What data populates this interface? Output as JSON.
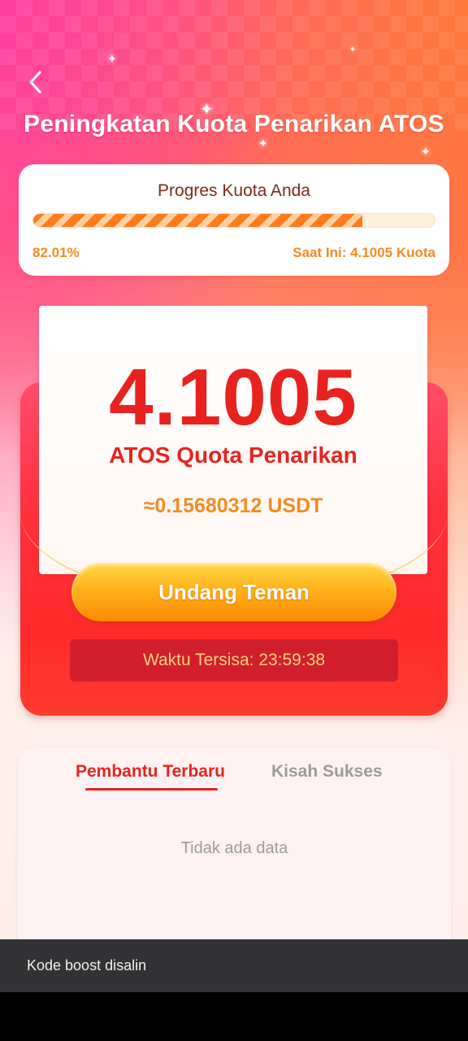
{
  "header": {
    "title": "Peningkatan Kuota Penarikan ATOS",
    "back_icon": "chevron-left-icon"
  },
  "progress": {
    "title": "Progres Kuota Anda",
    "percent_text": "82.01%",
    "percent_value": 0.8201,
    "current_text": "Saat Ini: 4.1005 Kuota"
  },
  "quota": {
    "amount": "4.1005",
    "label": "ATOS Quota Penarikan",
    "usdt": "≈0.15680312 USDT"
  },
  "actions": {
    "invite_label": "Undang Teman",
    "timer_text": "Waktu Tersisa: 23:59:38"
  },
  "tabs": {
    "items": [
      {
        "label": "Pembantu Terbaru",
        "active": true
      },
      {
        "label": "Kisah Sukses",
        "active": false
      }
    ],
    "empty_text": "Tidak ada data"
  },
  "toast": {
    "message": "Kode boost disalin"
  },
  "colors": {
    "accent_red": "#e8231f",
    "accent_orange": "#f58a1f",
    "toast_bg": "#323235"
  }
}
